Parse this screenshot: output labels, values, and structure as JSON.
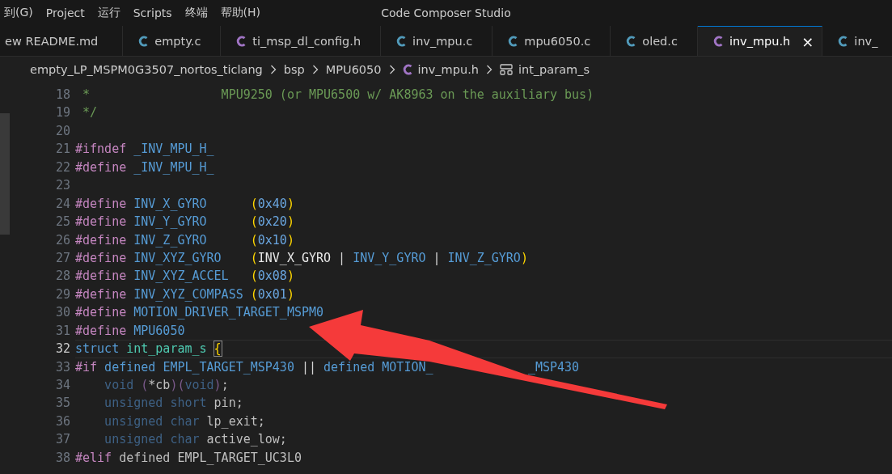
{
  "menu_bar": {
    "items": [
      "到(G)",
      "Project",
      "运行",
      "Scripts",
      "终端",
      "帮助(H)"
    ]
  },
  "window": {
    "title": "Code Composer Studio"
  },
  "tabs": [
    {
      "label": "ew README.md",
      "kind": "md",
      "selected": false
    },
    {
      "label": "empty.c",
      "kind": "c",
      "selected": false
    },
    {
      "label": "ti_msp_dl_config.h",
      "kind": "h",
      "selected": false
    },
    {
      "label": "inv_mpu.c",
      "kind": "c",
      "selected": false
    },
    {
      "label": "mpu6050.c",
      "kind": "c",
      "selected": false
    },
    {
      "label": "oled.c",
      "kind": "c",
      "selected": false
    },
    {
      "label": "inv_mpu.h",
      "kind": "h",
      "selected": true,
      "close": "×"
    },
    {
      "label": "inv_",
      "kind": "c",
      "selected": false
    }
  ],
  "breadcrumb": [
    {
      "label": "empty_LP_MSPM0G3507_nortos_ticlang",
      "kind": "folder"
    },
    {
      "label": "bsp",
      "kind": "folder"
    },
    {
      "label": "MPU6050",
      "kind": "folder"
    },
    {
      "label": "inv_mpu.h",
      "kind": "h-file"
    },
    {
      "label": "int_param_s",
      "kind": "struct"
    }
  ],
  "editor": {
    "lines": [
      {
        "number": "18",
        "current": false,
        "tokens": [
          {
            "kind": "comment",
            "text": " *                  MPU9250 (or MPU6500 w/ AK8963 on the auxiliary bus)"
          }
        ]
      },
      {
        "number": "19",
        "current": false,
        "tokens": [
          {
            "kind": "comment",
            "text": " */"
          }
        ]
      },
      {
        "number": "20",
        "current": false
      },
      {
        "number": "21",
        "current": false,
        "tokens": [
          {
            "kind": "directive",
            "text": "#ifndef"
          },
          {
            "kind": "macro",
            "text": " _INV_MPU_H_"
          }
        ]
      },
      {
        "number": "22",
        "current": false,
        "tokens": [
          {
            "kind": "directive",
            "text": "#define"
          },
          {
            "kind": "macro",
            "text": " _INV_MPU_H_"
          }
        ]
      },
      {
        "number": "23",
        "current": false
      },
      {
        "number": "24",
        "current": false,
        "tokens": [
          {
            "kind": "directive",
            "text": "#define"
          },
          {
            "kind": "macro",
            "text": " INV_X_GYRO      "
          },
          {
            "kind": "paren",
            "text": "("
          },
          {
            "kind": "number",
            "text": "0x40"
          },
          {
            "kind": "paren",
            "text": ")"
          }
        ]
      },
      {
        "number": "25",
        "current": false,
        "tokens": [
          {
            "kind": "directive",
            "text": "#define"
          },
          {
            "kind": "macro",
            "text": " INV_Y_GYRO      "
          },
          {
            "kind": "paren",
            "text": "("
          },
          {
            "kind": "number",
            "text": "0x20"
          },
          {
            "kind": "paren",
            "text": ")"
          }
        ]
      },
      {
        "number": "26",
        "current": false,
        "tokens": [
          {
            "kind": "directive",
            "text": "#define"
          },
          {
            "kind": "macro",
            "text": " INV_Z_GYRO      "
          },
          {
            "kind": "paren",
            "text": "("
          },
          {
            "kind": "number",
            "text": "0x10"
          },
          {
            "kind": "paren",
            "text": ")"
          }
        ]
      },
      {
        "number": "27",
        "current": false,
        "tokens": [
          {
            "kind": "directive",
            "text": "#define"
          },
          {
            "kind": "macro",
            "text": " INV_XYZ_GYRO    "
          },
          {
            "kind": "paren",
            "text": "("
          },
          {
            "kind": "bright",
            "text": "INV_X_GYRO"
          },
          {
            "kind": "plain",
            "text": " | "
          },
          {
            "kind": "macro",
            "text": "INV_Y_GYRO"
          },
          {
            "kind": "plain",
            "text": " | "
          },
          {
            "kind": "macro",
            "text": "INV_Z_GYRO"
          },
          {
            "kind": "paren",
            "text": ")"
          }
        ]
      },
      {
        "number": "28",
        "current": false,
        "tokens": [
          {
            "kind": "directive",
            "text": "#define"
          },
          {
            "kind": "macro",
            "text": " INV_XYZ_ACCEL   "
          },
          {
            "kind": "paren",
            "text": "("
          },
          {
            "kind": "number",
            "text": "0x08"
          },
          {
            "kind": "paren",
            "text": ")"
          }
        ]
      },
      {
        "number": "29",
        "current": false,
        "tokens": [
          {
            "kind": "directive",
            "text": "#define"
          },
          {
            "kind": "macro",
            "text": " INV_XYZ_COMPASS "
          },
          {
            "kind": "paren",
            "text": "("
          },
          {
            "kind": "number",
            "text": "0x01"
          },
          {
            "kind": "paren",
            "text": ")"
          }
        ]
      },
      {
        "number": "30",
        "current": false,
        "tokens": [
          {
            "kind": "directive",
            "text": "#define"
          },
          {
            "kind": "macro",
            "text": " MOTION_DRIVER_TARGET_MSPM0"
          }
        ]
      },
      {
        "number": "31",
        "current": false,
        "tokens": [
          {
            "kind": "directive",
            "text": "#define"
          },
          {
            "kind": "macro",
            "text": " MPU6050"
          }
        ]
      },
      {
        "number": "32",
        "current": true,
        "tokens": [
          {
            "kind": "keyword",
            "text": "struct"
          },
          {
            "kind": "type",
            "text": " int_param_s "
          },
          {
            "kind": "bracket-match",
            "text": "{"
          }
        ]
      },
      {
        "number": "33",
        "current": false,
        "tokens": [
          {
            "kind": "directive",
            "text": "#if"
          },
          {
            "kind": "keyword",
            "text": " defined "
          },
          {
            "kind": "macro",
            "text": "EMPL_TARGET_MSP430"
          },
          {
            "kind": "plain",
            "text": " || "
          },
          {
            "kind": "keyword",
            "text": "defined "
          },
          {
            "kind": "macro",
            "text": "MOTION_"
          },
          {
            "kind": "covered-macro",
            "text": "_MSP430"
          }
        ]
      },
      {
        "number": "34",
        "current": false,
        "tokens": [
          {
            "kind": "dim-keyword",
            "text": "    void "
          },
          {
            "kind": "dim-paren",
            "text": "("
          },
          {
            "kind": "dim-text",
            "text": "*cb"
          },
          {
            "kind": "dim-paren",
            "text": ")("
          },
          {
            "kind": "dim-keyword",
            "text": "void"
          },
          {
            "kind": "dim-paren",
            "text": ")"
          },
          {
            "kind": "dim-text",
            "text": ";"
          }
        ]
      },
      {
        "number": "35",
        "current": false,
        "tokens": [
          {
            "kind": "dim-keyword",
            "text": "    unsigned short"
          },
          {
            "kind": "dim-text",
            "text": " pin;"
          }
        ]
      },
      {
        "number": "36",
        "current": false,
        "tokens": [
          {
            "kind": "dim-keyword",
            "text": "    unsigned char"
          },
          {
            "kind": "dim-text",
            "text": " lp_exit;"
          }
        ]
      },
      {
        "number": "37",
        "current": false,
        "tokens": [
          {
            "kind": "dim-keyword",
            "text": "    unsigned char"
          },
          {
            "kind": "dim-text",
            "text": " active_low;"
          }
        ]
      },
      {
        "number": "38",
        "current": false,
        "tokens": [
          {
            "kind": "directive",
            "text": "#elif"
          },
          {
            "kind": "dim-text",
            "text": " defined EMPL_TARGET_UC3L0"
          }
        ]
      }
    ]
  }
}
